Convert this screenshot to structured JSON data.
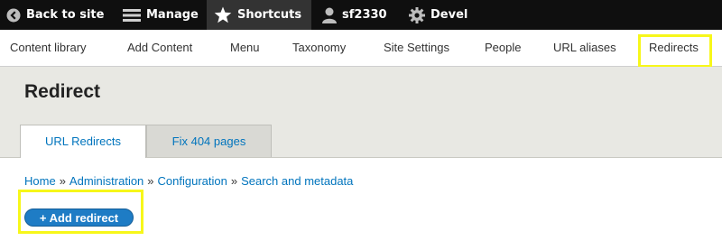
{
  "toolbar": {
    "back": "Back to site",
    "manage": "Manage",
    "shortcuts": "Shortcuts",
    "user": "sf2330",
    "devel": "Devel"
  },
  "tray": {
    "items": [
      "Content library",
      "Add Content",
      "Menu",
      "Taxonomy",
      "Site Settings",
      "People",
      "URL aliases",
      "Redirects"
    ]
  },
  "page": {
    "title": "Redirect",
    "tabs": [
      "URL Redirects",
      "Fix 404 pages"
    ],
    "breadcrumb": [
      "Home",
      "Administration",
      "Configuration",
      "Search and metadata"
    ],
    "breadcrumb_separator": "»",
    "add_button": "+ Add redirect"
  },
  "colors": {
    "toolbar_bg": "#0f0f0f",
    "link": "#0074bd",
    "button": "#1e7cc5",
    "highlight": "#f7f71a",
    "header_bg": "#e8e8e3"
  }
}
